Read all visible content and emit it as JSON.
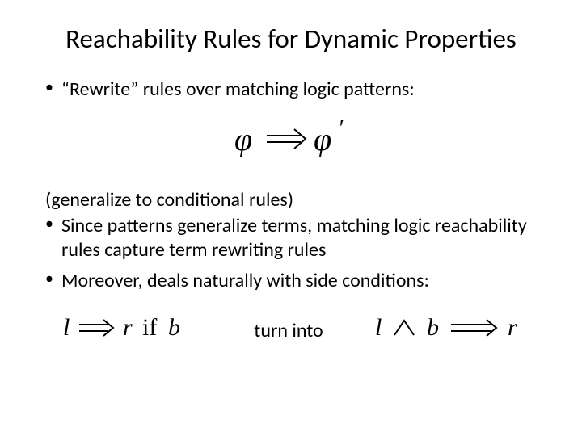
{
  "title": "Reachability Rules for Dynamic Properties",
  "bullets": {
    "b1": "“Rewrite” rules over matching logic patterns:",
    "b2": "Since patterns generalize terms, matching logic reachability rules capture term rewriting rules",
    "b3": "Moreover, deals naturally with side conditions:"
  },
  "plain": {
    "p1": "(generalize to conditional rules)"
  },
  "connective": "turn into",
  "formulas": {
    "top_alt": "phi ⇒ phi'",
    "left_alt": "l ⇒ r if b",
    "right_alt": "l ∧ b ⇒ r"
  }
}
